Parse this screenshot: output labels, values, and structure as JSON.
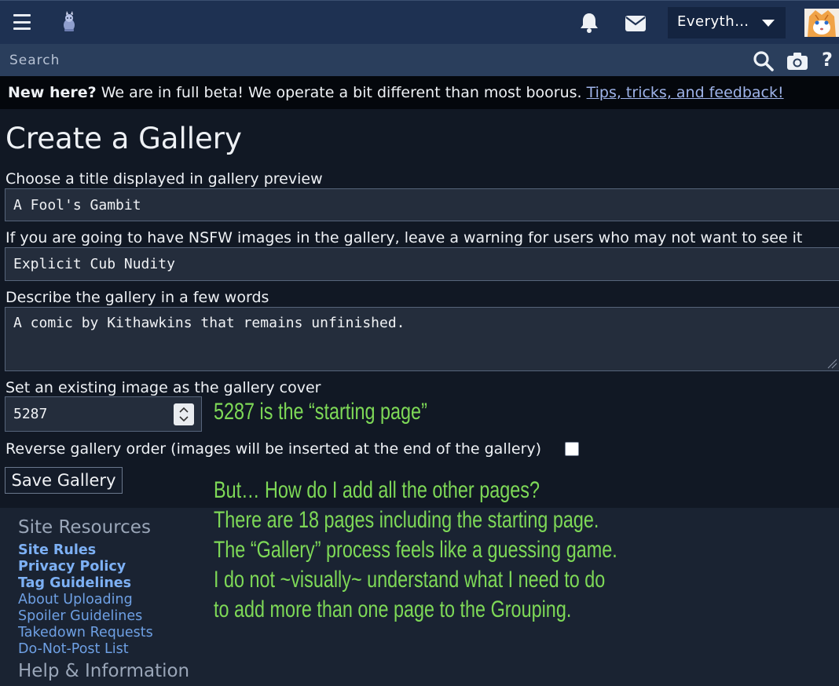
{
  "header": {
    "filter_label": "Everyth…",
    "search_placeholder": "Search",
    "help_symbol": "?"
  },
  "notice": {
    "lead": "New here?",
    "text": " We are in full beta! We operate a bit different than most boorus. ",
    "link": "Tips, tricks, and feedback!"
  },
  "form": {
    "page_title": "Create a Gallery",
    "title_label": "Choose a title displayed in gallery preview",
    "title_value": "A Fool's Gambit",
    "warning_label": "If you are going to have NSFW images in the gallery, leave a warning for users who may not want to see it",
    "warning_value": "Explicit Cub Nudity",
    "description_label": "Describe the gallery in a few words",
    "description_value": "A comic by Kithawkins that remains unfinished.",
    "cover_label": "Set an existing image as the gallery cover",
    "cover_value": "5287",
    "reverse_label": "Reverse gallery order (images will be inserted at the end of the gallery)",
    "reverse_checked": false,
    "save_label": "Save Gallery"
  },
  "annotations": {
    "line1": "5287 is the “starting page”",
    "line2": "But… How do I add all the other pages?",
    "line3": "There are 18 pages including the starting page.",
    "line4": "The “Gallery” process feels like a guessing game.",
    "line5": "I do not ~visually~ understand what I need to do",
    "line6": "to add more than one page to the Grouping."
  },
  "footer": {
    "section1_title": "Site Resources",
    "links": [
      "Site Rules",
      "Privacy Policy",
      "Tag Guidelines",
      "About Uploading",
      "Spoiler Guidelines",
      "Takedown Requests",
      "Do-Not-Post List"
    ],
    "section2_title": "Help & Information"
  },
  "colors": {
    "topbar": "#1e3152",
    "searchbar": "#2a3e5c",
    "annotation": "#7ed957",
    "link": "#6ea0e4"
  }
}
